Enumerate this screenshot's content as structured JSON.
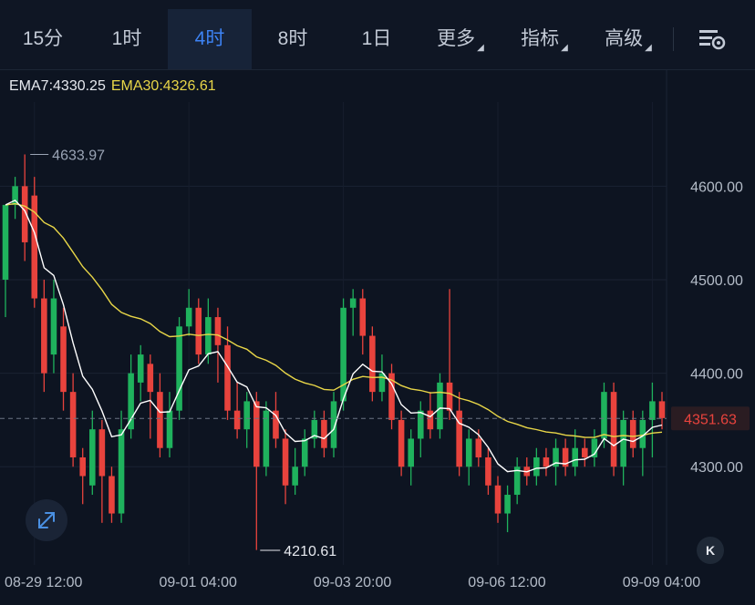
{
  "toolbar": {
    "tabs": [
      {
        "label": "15分",
        "active": false,
        "dropdown": false
      },
      {
        "label": "1时",
        "active": false,
        "dropdown": false
      },
      {
        "label": "4时",
        "active": true,
        "dropdown": false
      },
      {
        "label": "8时",
        "active": false,
        "dropdown": false
      },
      {
        "label": "1日",
        "active": false,
        "dropdown": false
      },
      {
        "label": "更多",
        "active": false,
        "dropdown": true
      },
      {
        "label": "指标",
        "active": false,
        "dropdown": true
      },
      {
        "label": "高级",
        "active": false,
        "dropdown": true
      }
    ],
    "settings_icon": "chart-settings-icon"
  },
  "indicators": {
    "ema7_label": "EMA7:4330.25",
    "ema30_label": "EMA30:4326.61"
  },
  "colors": {
    "up": "#1fb25d",
    "down": "#e8433d",
    "ema7": "#ffffff",
    "ema30": "#e8d648",
    "active_tab": "#3d83f5",
    "last_price_tag": "#e8433d"
  },
  "chart_data": {
    "type": "candlestick",
    "interval": "4h",
    "y_ticks": [
      "4600.00",
      "4500.00",
      "4400.00",
      "4300.00"
    ],
    "y_tick_values": [
      4600,
      4500,
      4400,
      4300
    ],
    "ylim": [
      4195,
      4690
    ],
    "x_ticks": [
      "08-29 12:00",
      "09-01 04:00",
      "09-03 20:00",
      "09-06 12:00",
      "09-09 04:00"
    ],
    "x_tick_index": [
      3,
      19,
      35,
      51,
      67
    ],
    "high_marker": {
      "label": "4633.97",
      "value": 4633.97,
      "index": 2
    },
    "low_marker": {
      "label": "4210.61",
      "value": 4210.61,
      "index": 26
    },
    "last_price": {
      "label": "4351.63",
      "value": 4351.63
    },
    "candles": [
      [
        4500,
        4580,
        4570,
        4460
      ],
      [
        4580,
        4600,
        4610,
        4565
      ],
      [
        4600,
        4540,
        4634,
        4520
      ],
      [
        4590,
        4480,
        4610,
        4470
      ],
      [
        4480,
        4400,
        4500,
        4380
      ],
      [
        4420,
        4480,
        4500,
        4400
      ],
      [
        4450,
        4380,
        4470,
        4360
      ],
      [
        4380,
        4310,
        4400,
        4300
      ],
      [
        4310,
        4290,
        4320,
        4260
      ],
      [
        4280,
        4340,
        4360,
        4270
      ],
      [
        4340,
        4290,
        4350,
        4240
      ],
      [
        4290,
        4250,
        4300,
        4240
      ],
      [
        4250,
        4340,
        4360,
        4240
      ],
      [
        4340,
        4400,
        4420,
        4330
      ],
      [
        4390,
        4420,
        4430,
        4370
      ],
      [
        4410,
        4380,
        4420,
        4330
      ],
      [
        4380,
        4320,
        4400,
        4310
      ],
      [
        4320,
        4360,
        4380,
        4310
      ],
      [
        4360,
        4450,
        4460,
        4350
      ],
      [
        4450,
        4470,
        4490,
        4440
      ],
      [
        4470,
        4420,
        4480,
        4410
      ],
      [
        4420,
        4460,
        4480,
        4410
      ],
      [
        4460,
        4430,
        4470,
        4390
      ],
      [
        4430,
        4360,
        4450,
        4350
      ],
      [
        4360,
        4340,
        4390,
        4330
      ],
      [
        4340,
        4370,
        4380,
        4320
      ],
      [
        4370,
        4300,
        4380,
        4211
      ],
      [
        4300,
        4360,
        4370,
        4290
      ],
      [
        4360,
        4330,
        4380,
        4320
      ],
      [
        4330,
        4280,
        4340,
        4260
      ],
      [
        4280,
        4300,
        4320,
        4270
      ],
      [
        4300,
        4330,
        4340,
        4290
      ],
      [
        4330,
        4350,
        4360,
        4320
      ],
      [
        4350,
        4320,
        4360,
        4310
      ],
      [
        4320,
        4370,
        4380,
        4310
      ],
      [
        4370,
        4470,
        4480,
        4360
      ],
      [
        4470,
        4480,
        4490,
        4440
      ],
      [
        4480,
        4440,
        4490,
        4420
      ],
      [
        4440,
        4380,
        4450,
        4370
      ],
      [
        4380,
        4400,
        4420,
        4370
      ],
      [
        4400,
        4350,
        4410,
        4340
      ],
      [
        4350,
        4300,
        4360,
        4290
      ],
      [
        4300,
        4330,
        4340,
        4280
      ],
      [
        4330,
        4360,
        4370,
        4310
      ],
      [
        4360,
        4340,
        4380,
        4330
      ],
      [
        4340,
        4390,
        4400,
        4330
      ],
      [
        4390,
        4360,
        4490,
        4350
      ],
      [
        4360,
        4300,
        4380,
        4290
      ],
      [
        4300,
        4330,
        4340,
        4280
      ],
      [
        4330,
        4310,
        4340,
        4300
      ],
      [
        4310,
        4280,
        4320,
        4270
      ],
      [
        4280,
        4250,
        4290,
        4240
      ],
      [
        4250,
        4270,
        4280,
        4230
      ],
      [
        4270,
        4300,
        4310,
        4260
      ],
      [
        4300,
        4290,
        4310,
        4280
      ],
      [
        4290,
        4310,
        4320,
        4280
      ],
      [
        4310,
        4300,
        4320,
        4290
      ],
      [
        4300,
        4320,
        4330,
        4280
      ],
      [
        4320,
        4300,
        4330,
        4290
      ],
      [
        4300,
        4320,
        4340,
        4290
      ],
      [
        4320,
        4310,
        4330,
        4300
      ],
      [
        4310,
        4330,
        4340,
        4300
      ],
      [
        4330,
        4380,
        4390,
        4320
      ],
      [
        4380,
        4300,
        4390,
        4290
      ],
      [
        4300,
        4350,
        4360,
        4280
      ],
      [
        4350,
        4320,
        4360,
        4310
      ],
      [
        4320,
        4350,
        4360,
        4290
      ],
      [
        4350,
        4370,
        4390,
        4310
      ],
      [
        4370,
        4352,
        4380,
        4340
      ]
    ]
  }
}
